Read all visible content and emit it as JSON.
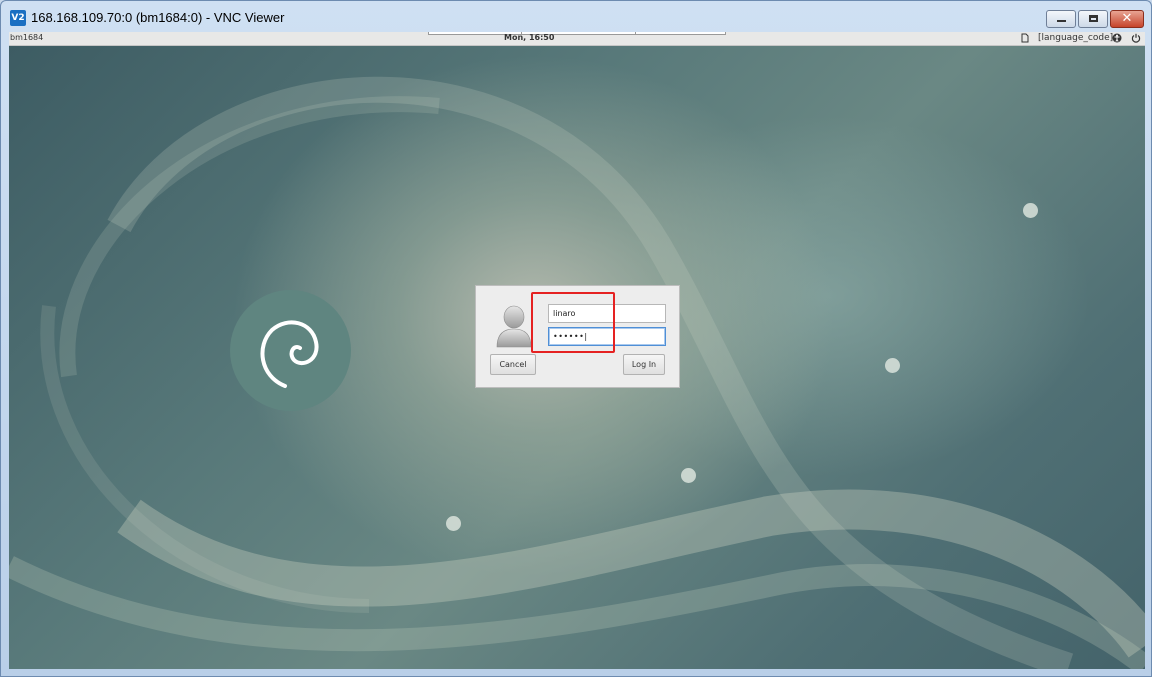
{
  "window": {
    "app_icon": "V2",
    "title": "168.168.109.70:0 (bm1684:0) - VNC Viewer",
    "controls": {
      "minimize": "minimize-icon",
      "maximize": "maximize-icon",
      "close": "✕"
    }
  },
  "topbar": {
    "hostname": "bm1684",
    "clock": "Mon, 16:50",
    "language": "[language_code]",
    "icons": [
      "document-icon",
      "accessibility-icon",
      "power-icon"
    ]
  },
  "login": {
    "username": "linaro",
    "password_mask": "••••••|",
    "cancel_label": "Cancel",
    "login_label": "Log In"
  },
  "colors": {
    "highlight": "#e52222",
    "focus_border": "#4f8fd6",
    "desktop_teal": "#44605f"
  }
}
